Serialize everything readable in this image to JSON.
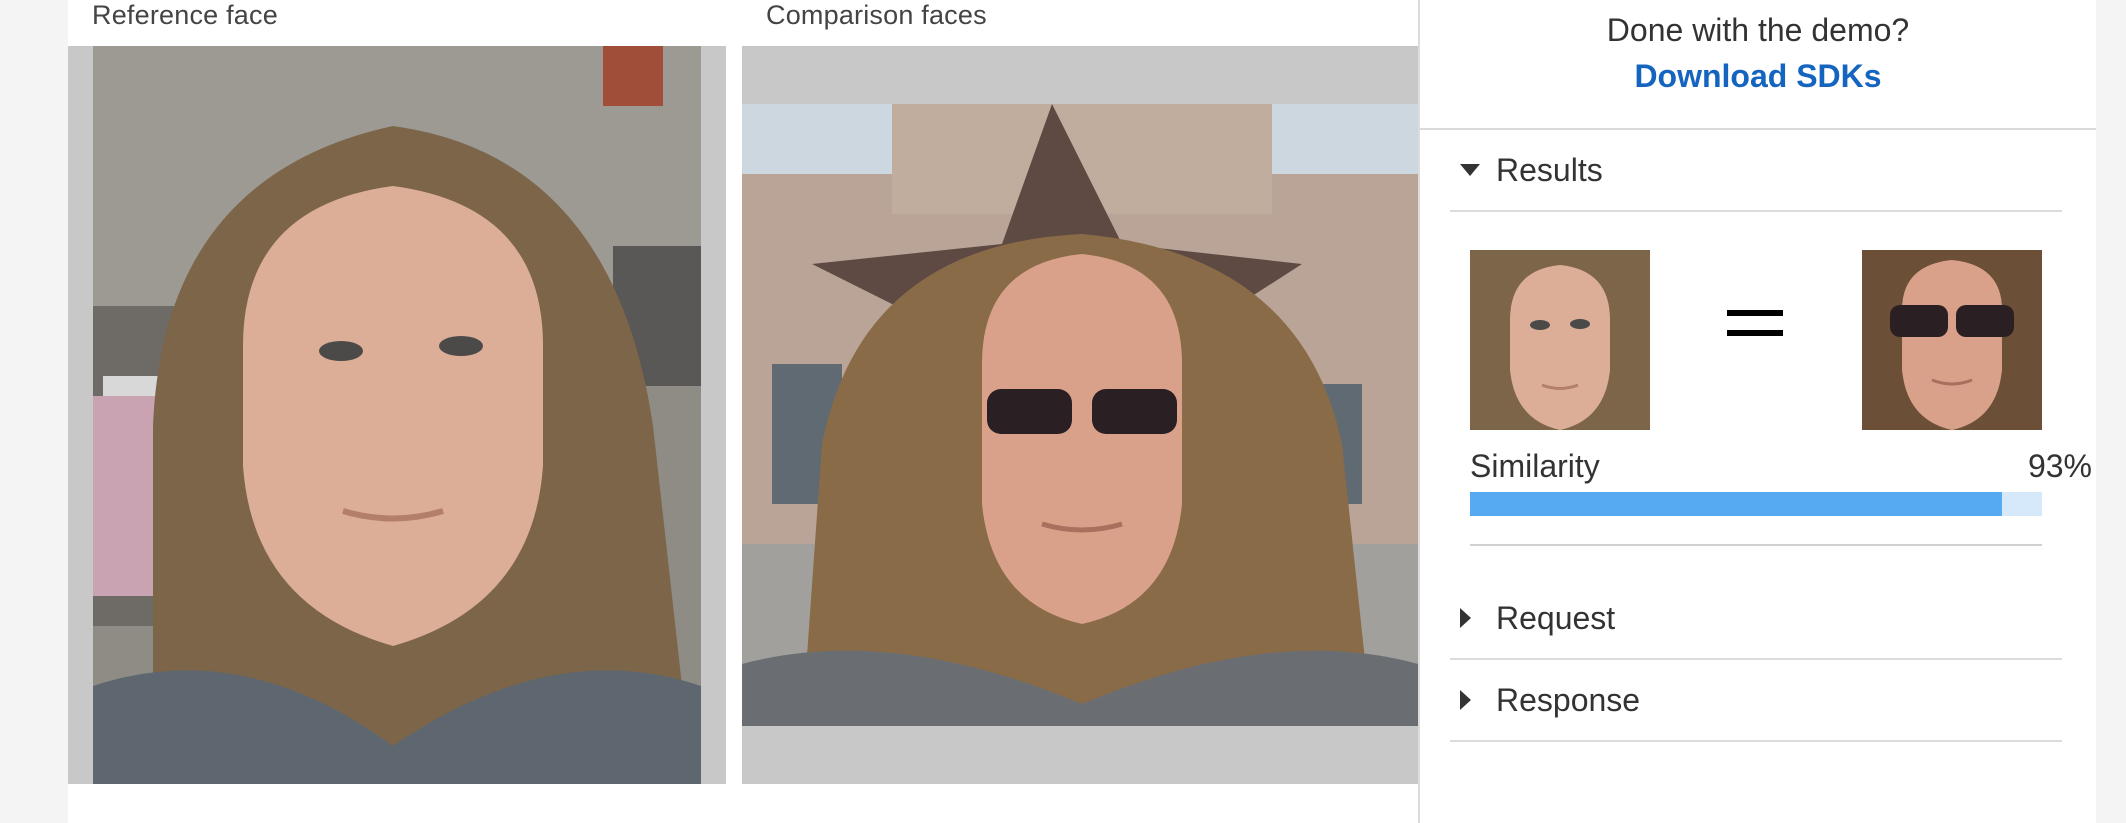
{
  "left": {
    "reference_label": "Reference face",
    "comparison_label": "Comparison faces"
  },
  "side": {
    "done_text": "Done with the demo?",
    "download_link": "Download SDKs",
    "sections": {
      "results": "Results",
      "request": "Request",
      "response": "Response"
    },
    "results": {
      "equals": "=",
      "similarity_label": "Similarity",
      "similarity_value": "93%",
      "similarity_fraction": 0.93
    }
  },
  "colors": {
    "link": "#1565c0",
    "bar_fill": "#55aaf2",
    "bar_track": "#d6e9fb"
  },
  "icons": [
    "triangle-down-icon",
    "triangle-right-icon",
    "equals-icon"
  ]
}
